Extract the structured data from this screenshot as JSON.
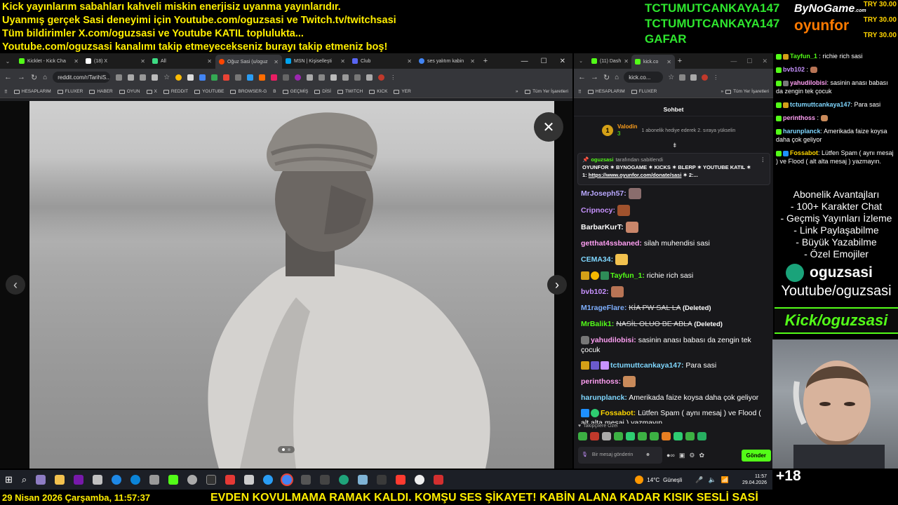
{
  "overlay": {
    "top_lines": [
      "Kick yayınlarım sabahları kahveli miskin enerjisiz uyanma yayınlarıdır.",
      "Uyanmış gerçek Sasi deneyimi için Youtube.com/oguzsasi ve Twitch.tv/twitchsasi",
      "Tüm bildirimler X.com/oguzsasi ve Youtube KATIL toplulukta...",
      "Youtube.com/oguzsasi kanalımı takip etmeyecekseniz burayı takip etmeniz boş!"
    ],
    "gift_names": [
      "TCTUMUTCANKAYA147",
      "TCTUMUTCANKAYA147",
      "GAFAR"
    ],
    "sponsor1": "ByNoGame",
    "sponsor1_sub": ".com",
    "sponsor2": "oyunfor",
    "try_values": [
      "TRY 30.00",
      "TRY 30.00",
      "TRY 30.00"
    ],
    "bottom_date": "29 Nisan 2026 Çarşamba, 11:57:37",
    "bottom_ticker": "EVDEN KOVULMAMA RAMAK KALDI. KOMŞU SES ŞİKAYET! KABİN ALANA KADAR KISIK SESLİ SASİ",
    "viewer_extra": "+18"
  },
  "left_browser": {
    "tabs": [
      {
        "label": "Kicklet - Kick Cha",
        "color": "#53fc18"
      },
      {
        "label": "(18) X",
        "color": "#ffffff"
      },
      {
        "label": "All",
        "color": "#3ddc84"
      },
      {
        "label": "Oğuz Sasi (u/oguz",
        "color": "#ff4500"
      },
      {
        "label": "MSN | Kişiselleşti",
        "color": "#00a4ef"
      },
      {
        "label": "Club",
        "color": "#5865f2"
      },
      {
        "label": "ses yalıtım kabin",
        "color": "#4285f4"
      }
    ],
    "url": "reddit.com/r/TarihiS...",
    "bookmarks": [
      "HESAPLARIM",
      "FLUXER",
      "HABER",
      "OYUN",
      "X",
      "REDDIT",
      "YOUTUBE",
      "BROWSER-G",
      "B",
      "GEÇMİŞ",
      "DİSİ",
      "TWITCH",
      "KICK",
      "YER"
    ],
    "all_bookmarks": "Tüm Yer İşaretleri",
    "photo_close": "✕",
    "prev": "‹",
    "next": "›"
  },
  "right_browser": {
    "tabs": [
      {
        "label": "(11) Dash",
        "color": "#53fc18"
      },
      {
        "label": "kick.co",
        "color": "#53fc18"
      }
    ],
    "url": "kick.co...",
    "bookmarks": [
      "HESAPLARIM",
      "FLUXER"
    ],
    "all_bookmarks": "Tüm Yer İşaretleri"
  },
  "chat": {
    "header": "Sohbet",
    "gifter_rank": "1",
    "gifter_name": "Valodin",
    "gifter_count": "3",
    "gifter_text": "1 abonelik hediye ederek 2. sıraya yükselin",
    "pinned_by": "oguzsasi",
    "pinned_label": "tarafından sabitlendi",
    "pinned_text": "OYUNFOR ✶ BYNOGAME ✶ KICKS ✶ BLERP ✶ YOUTUBE KATIL ✶",
    "pinned_link_prefix": "1:",
    "pinned_link": "https://www.oyunfor.com/donate/sasi",
    "pinned_link_suffix": "✶ 2:...",
    "messages": [
      {
        "user": "MrJoseph57:",
        "color": "#b9a8ff",
        "text": "",
        "emote": "#8a6d6d"
      },
      {
        "user": "Cripnocy:",
        "color": "#c792ff",
        "text": "",
        "emote": "#a0522d"
      },
      {
        "user": "BarbarKurT:",
        "color": "#ffffff",
        "text": "",
        "emote": "#c9866a"
      },
      {
        "user": "getthat4ssbaned:",
        "color": "#ff9ff3",
        "text": "silah muhendisi sasi"
      },
      {
        "user": "CEMA34:",
        "color": "#7fd7ff",
        "text": "",
        "emote": "#f2c14e"
      },
      {
        "user": "Tayfun_1:",
        "color": "#53fc18",
        "text": "richie rich sasi"
      },
      {
        "user": "bvb102:",
        "color": "#c792ff",
        "text": "",
        "emote": "#b87455"
      },
      {
        "user": "M1rageFlare:",
        "color": "#7fb0ff",
        "text": "KİA PW SAL LA",
        "deleted": "(Deleted)"
      },
      {
        "user": "MrBalik1:",
        "color": "#53fc18",
        "text": "NASİL OLUO BE ABLA",
        "deleted": "(Deleted)"
      },
      {
        "user": "yahudilobisi:",
        "color": "#ff9ff3",
        "text": "sasinin anası babası da zengin tek çocuk"
      },
      {
        "user": "tctumuttcankaya147:",
        "color": "#7fd7ff",
        "text": "Para sasi"
      },
      {
        "user": "perinthoss:",
        "color": "#ff9ff3",
        "text": "",
        "emote": "#c98a5a"
      },
      {
        "user": "harunplanck:",
        "color": "#7fd7ff",
        "text": "Amerikada faize koysa daha çok geliyor"
      },
      {
        "user": "Fossabot:",
        "color": "#ffd700",
        "text": "Lütfen Spam ( aynı mesaj ) ve Flood ( alt alta mesaj ) yazmayın."
      }
    ],
    "followers_label": "Takipçilere Özel",
    "input_placeholder": "Bir mesaj gönderin",
    "send_label": "Gönder"
  },
  "side_chat": [
    {
      "user": "Tayfun_1",
      "color": "#53fc18",
      "text": ": richie rich sasi"
    },
    {
      "user": "bvb102",
      "color": "#c792ff",
      "text": ":"
    },
    {
      "user": "yahudilobisi",
      "color": "#ff9ff3",
      "text": ": sasinin anası babası da zengin tek çocuk"
    },
    {
      "user": "tctumuttcankaya147",
      "color": "#7fd7ff",
      "text": ": Para sasi"
    },
    {
      "user": "perinthoss",
      "color": "#ff9ff3",
      "text": ":"
    },
    {
      "user": "harunplanck",
      "color": "#7fd7ff",
      "text": ": Amerikada faize koysa daha çok geliyor"
    },
    {
      "user": "Fossabot",
      "color": "#ffd700",
      "text": ": Lütfen Spam ( aynı mesaj ) ve Flood ( alt alta mesaj ) yazmayın."
    }
  ],
  "perks": {
    "title": "Abonelik Avantajları",
    "items": [
      "- 100+ Karakter Chat",
      "- Geçmiş Yayınları İzleme",
      "- Link Paylaşabilme",
      "- Büyük Yazabilme",
      "- Özel Emojiler"
    ]
  },
  "socials": {
    "twitch_name": "oguzsasi",
    "youtube": "Youtube/oguzsasi",
    "kick": "Kick/oguzsasi"
  },
  "taskbar": {
    "weather": "14°C",
    "weather_desc": "Güneşli",
    "time": "11:57",
    "date": "29.04.2026"
  }
}
